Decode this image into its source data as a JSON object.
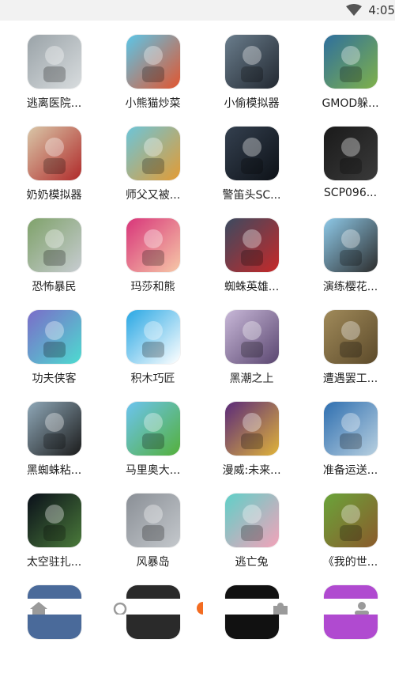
{
  "status_bar": {
    "time": "4:05"
  },
  "apps": [
    {
      "label": "逃离医院...",
      "icon": "escape-hospital-icon",
      "c1": "#9aa3a8",
      "c2": "#d8dcde"
    },
    {
      "label": "小熊猫炒菜",
      "icon": "panda-cooking-icon",
      "c1": "#5bc6e8",
      "c2": "#e2552f"
    },
    {
      "label": "小偷模拟器",
      "icon": "thief-simulator-icon",
      "c1": "#6a7d8c",
      "c2": "#222831"
    },
    {
      "label": "GMOD躲...",
      "icon": "gmod-icon",
      "c1": "#2e6f9e",
      "c2": "#7fb14a"
    },
    {
      "label": "奶奶模拟器",
      "icon": "granny-simulator-icon",
      "c1": "#d9c7a8",
      "c2": "#b02a2a"
    },
    {
      "label": "师父又被...",
      "icon": "master-rescue-icon",
      "c1": "#6cc5d9",
      "c2": "#e39b33"
    },
    {
      "label": "警笛头SC...",
      "icon": "siren-head-icon",
      "c1": "#34404f",
      "c2": "#0d1117"
    },
    {
      "label": "SCP096...",
      "icon": "scp096-icon",
      "c1": "#1a1a1a",
      "c2": "#3a3a3a"
    },
    {
      "label": "恐怖暴民",
      "icon": "horror-mob-icon",
      "c1": "#7fa26a",
      "c2": "#c7ccd1"
    },
    {
      "label": "玛莎和熊",
      "icon": "masha-bear-icon",
      "c1": "#d8357a",
      "c2": "#f6c8a7"
    },
    {
      "label": "蜘蛛英雄...",
      "icon": "spider-hero-icon",
      "c1": "#3b4b61",
      "c2": "#c62828"
    },
    {
      "label": "演练樱花...",
      "icon": "sakura-school-icon",
      "c1": "#8ec9e8",
      "c2": "#2c2c2c"
    },
    {
      "label": "功夫侠客",
      "icon": "kungfu-icon",
      "c1": "#7b6cc9",
      "c2": "#4ddbd0"
    },
    {
      "label": "积木巧匠",
      "icon": "block-craft-icon",
      "c1": "#29a7e4",
      "c2": "#ffffff"
    },
    {
      "label": "黑潮之上",
      "icon": "black-tide-icon",
      "c1": "#c8b8d8",
      "c2": "#5a4670"
    },
    {
      "label": "遭遇罢工...",
      "icon": "strike-icon",
      "c1": "#a08a5a",
      "c2": "#5c4a2a"
    },
    {
      "label": "黑蜘蛛粘...",
      "icon": "black-spider-icon",
      "c1": "#8fa8b8",
      "c2": "#1b1b1b"
    },
    {
      "label": "马里奥大...",
      "icon": "mario-icon",
      "c1": "#6cc4f0",
      "c2": "#54b03b"
    },
    {
      "label": "漫威:未来...",
      "icon": "marvel-icon",
      "c1": "#5a2a7a",
      "c2": "#e0b33a"
    },
    {
      "label": "准备运送...",
      "icon": "car-transport-icon",
      "c1": "#2f6fb0",
      "c2": "#b8d0e0"
    },
    {
      "label": "太空驻扎...",
      "icon": "space-station-icon",
      "c1": "#0a0f1a",
      "c2": "#4a7a3a"
    },
    {
      "label": "风暴岛",
      "icon": "storm-island-icon",
      "c1": "#8a8f96",
      "c2": "#c4c8cc"
    },
    {
      "label": "逃亡兔",
      "icon": "escape-rabbit-icon",
      "c1": "#5fd0c8",
      "c2": "#f3a2b9"
    },
    {
      "label": "《我的世...",
      "icon": "minecraft-icon",
      "c1": "#6aa43a",
      "c2": "#8b5a2b"
    }
  ],
  "partial_row": [
    {
      "icon": "partial-app-icon-1",
      "c1": "#4a6a9a"
    },
    {
      "icon": "partial-app-icon-2",
      "c1": "#2a2a2a"
    },
    {
      "icon": "partial-app-icon-3",
      "c1": "#111111"
    },
    {
      "icon": "partial-app-icon-4",
      "c1": "#b04ad0"
    }
  ],
  "bottom_nav": [
    {
      "name": "home-icon"
    },
    {
      "name": "search-icon"
    },
    {
      "name": "game-icon",
      "color": "#f36c21"
    },
    {
      "name": "puzzle-icon"
    },
    {
      "name": "profile-icon"
    }
  ]
}
